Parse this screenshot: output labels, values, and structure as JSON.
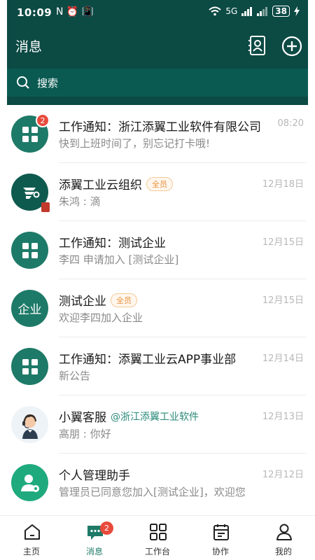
{
  "status_bar": {
    "time": "10:09",
    "left_icons": "N ⏰ 📳",
    "network": "5G",
    "battery": "38"
  },
  "header": {
    "title": "消息"
  },
  "search": {
    "label": "搜索"
  },
  "conversations": [
    {
      "name": "工作通知：浙江添翼工业软件有限公司",
      "preview": "快到上班时间了，别忘记打卡哦!",
      "time": "08:20",
      "badge": "2",
      "avatar_icon": "grid-icon",
      "tag": "",
      "mention": ""
    },
    {
      "name": "添翼工业云组织",
      "preview": "朱鸿 : 滴",
      "time": "12月18日",
      "badge": "",
      "avatar_icon": "logo-icon",
      "tag": "全员",
      "mention": ""
    },
    {
      "name": "工作通知：测试企业",
      "preview": "李四 申请加入 [测试企业]",
      "time": "12月15日",
      "badge": "",
      "avatar_icon": "grid-icon",
      "tag": "",
      "mention": ""
    },
    {
      "name": "测试企业",
      "preview": "欢迎李四加入企业",
      "time": "12月15日",
      "badge": "",
      "avatar_text": "企业",
      "avatar_icon": "",
      "tag": "全员",
      "mention": ""
    },
    {
      "name": "工作通知：添翼工业云APP事业部",
      "preview": "新公告",
      "time": "12月14日",
      "badge": "",
      "avatar_icon": "grid-icon",
      "tag": "",
      "mention": ""
    },
    {
      "name": "小翼客服",
      "preview": "高朋 : 你好",
      "time": "12月13日",
      "badge": "",
      "avatar_icon": "agent-icon",
      "tag": "",
      "mention": "@浙江添翼工业软件"
    },
    {
      "name": "个人管理助手",
      "preview": "管理员已同意您加入[测试企业]，欢迎您",
      "time": "12月12日",
      "badge": "",
      "avatar_icon": "user-gear-icon",
      "tag": "",
      "mention": ""
    }
  ],
  "tabs": [
    {
      "label": "主页",
      "icon": "home-icon",
      "badge": ""
    },
    {
      "label": "消息",
      "icon": "chat-icon",
      "badge": "2",
      "active": true
    },
    {
      "label": "工作台",
      "icon": "grid-icon",
      "badge": ""
    },
    {
      "label": "协作",
      "icon": "calendar-icon",
      "badge": ""
    },
    {
      "label": "我的",
      "icon": "person-icon",
      "badge": ""
    }
  ],
  "colors": {
    "header": "#0c4a44",
    "accent": "#1e7a68",
    "badge": "#e84a3c",
    "tag": "#e8913b"
  }
}
